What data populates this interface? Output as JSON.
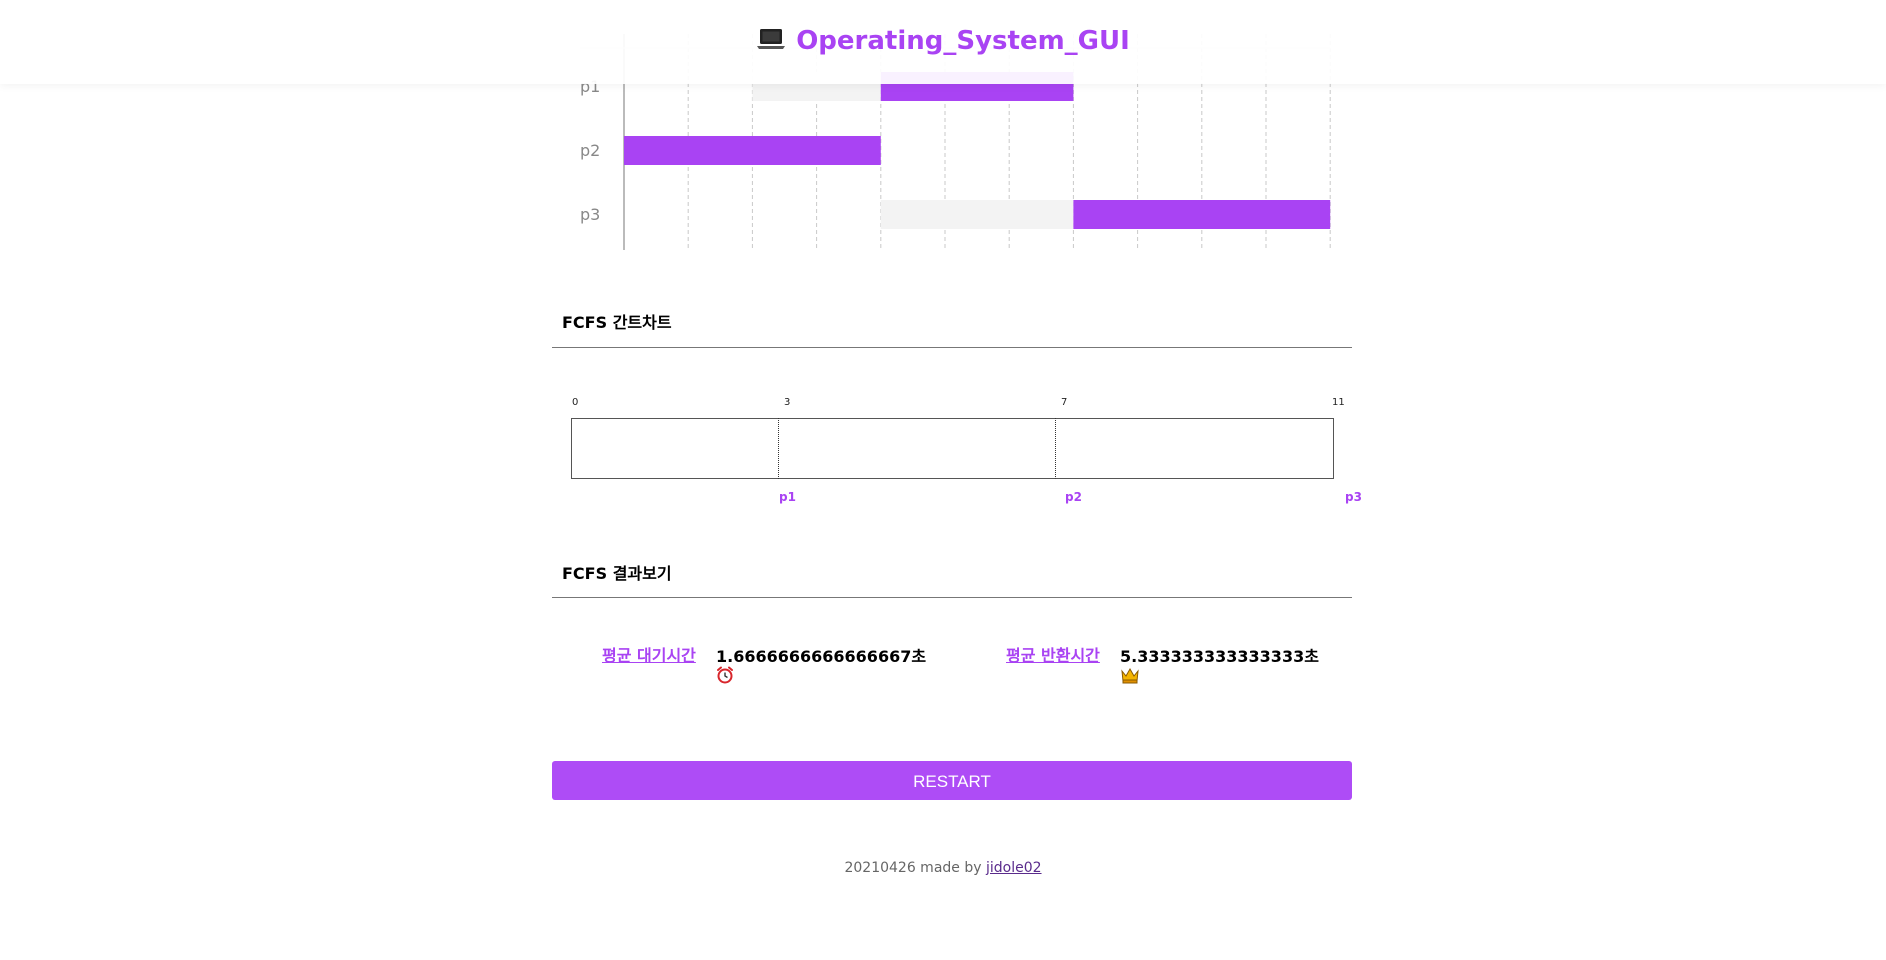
{
  "header": {
    "title": "Operating_System_GUI",
    "icon": "laptop-icon"
  },
  "timeline": {
    "processes": [
      "p1",
      "p2",
      "p3"
    ],
    "segments": [
      {
        "process": "p1",
        "kind": "wait",
        "start": 2,
        "end": 4
      },
      {
        "process": "p1",
        "kind": "run",
        "start": 4,
        "end": 7
      },
      {
        "process": "p2",
        "kind": "run",
        "start": 0,
        "end": 4
      },
      {
        "process": "p3",
        "kind": "wait",
        "start": 4,
        "end": 7
      },
      {
        "process": "p3",
        "kind": "run",
        "start": 7,
        "end": 11
      }
    ],
    "x_max": 11,
    "colors": {
      "run": "#a943f3",
      "wait": "#f3f3f3"
    }
  },
  "gantt": {
    "title": "FCFS 간트차트",
    "ticks": [
      "0",
      "3",
      "7",
      "11"
    ],
    "labels": [
      "p1",
      "p2",
      "p3"
    ]
  },
  "results": {
    "title": "FCFS 결과보기",
    "avg_wait_label": "평균 대기시간",
    "avg_wait_value": "1.6666666666666667초",
    "avg_wait_icon": "alarm-clock-icon",
    "avg_turnaround_label": "평균 반환시간",
    "avg_turnaround_value": "5.333333333333333초",
    "avg_turnaround_icon": "crown-icon"
  },
  "restart_label": "RESTART",
  "footer": {
    "text": "20210426 made by ",
    "link": "jidole02"
  },
  "colors": {
    "accent": "#a943f3",
    "button": "#ae4cf6"
  }
}
